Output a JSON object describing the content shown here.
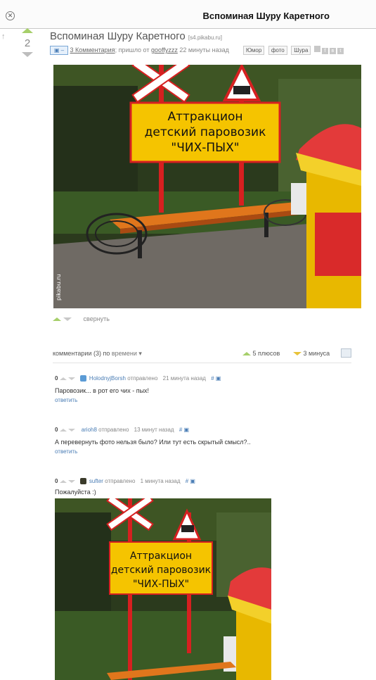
{
  "window": {
    "title": "Вспоминая Шуру Каретного"
  },
  "post": {
    "score": "2",
    "title": "Вспоминая Шуру Каретного",
    "source": "[s4.pikabu.ru]",
    "camera_label": "▣ –",
    "comments_link": "3 Комментария",
    "posted_text": "; пришло от ",
    "author": "gooffyzzz",
    "time": "22 минуты назад",
    "tags": [
      "Юмор",
      "фото",
      "Шура"
    ],
    "collapse_label": "свернуть",
    "image": {
      "line1": "Аттракцион",
      "line2": "детский паровозик",
      "line3": "\"ЧИХ-ПЫХ\"",
      "watermark": "pikabu.ru"
    }
  },
  "comments_header": {
    "label": "комментарии (3) по",
    "sort": "времени ▾",
    "plus": "5 плюсов",
    "minus": "3 минуса"
  },
  "comments": [
    {
      "score": "0",
      "user": "HolodnyjBorsh",
      "sent": "отправлено",
      "time": "21 минута назад",
      "text": "Паровозик... в рот его чих - пых!",
      "reply": "ответить",
      "avatar": "#5b9bd5"
    },
    {
      "score": "0",
      "user": "arioh8",
      "sent": "отправлено",
      "time": "13 минут назад",
      "text": "А перевернуть фото нельзя было? Или тут есть скрытый смысл?..",
      "reply": "ответить",
      "avatar": ""
    },
    {
      "score": "0",
      "user": "sufter",
      "sent": "отправлено",
      "time": "1 минута назад",
      "text": "Пожалуйста :)",
      "reply": "",
      "avatar": "#3b3b2b"
    }
  ]
}
